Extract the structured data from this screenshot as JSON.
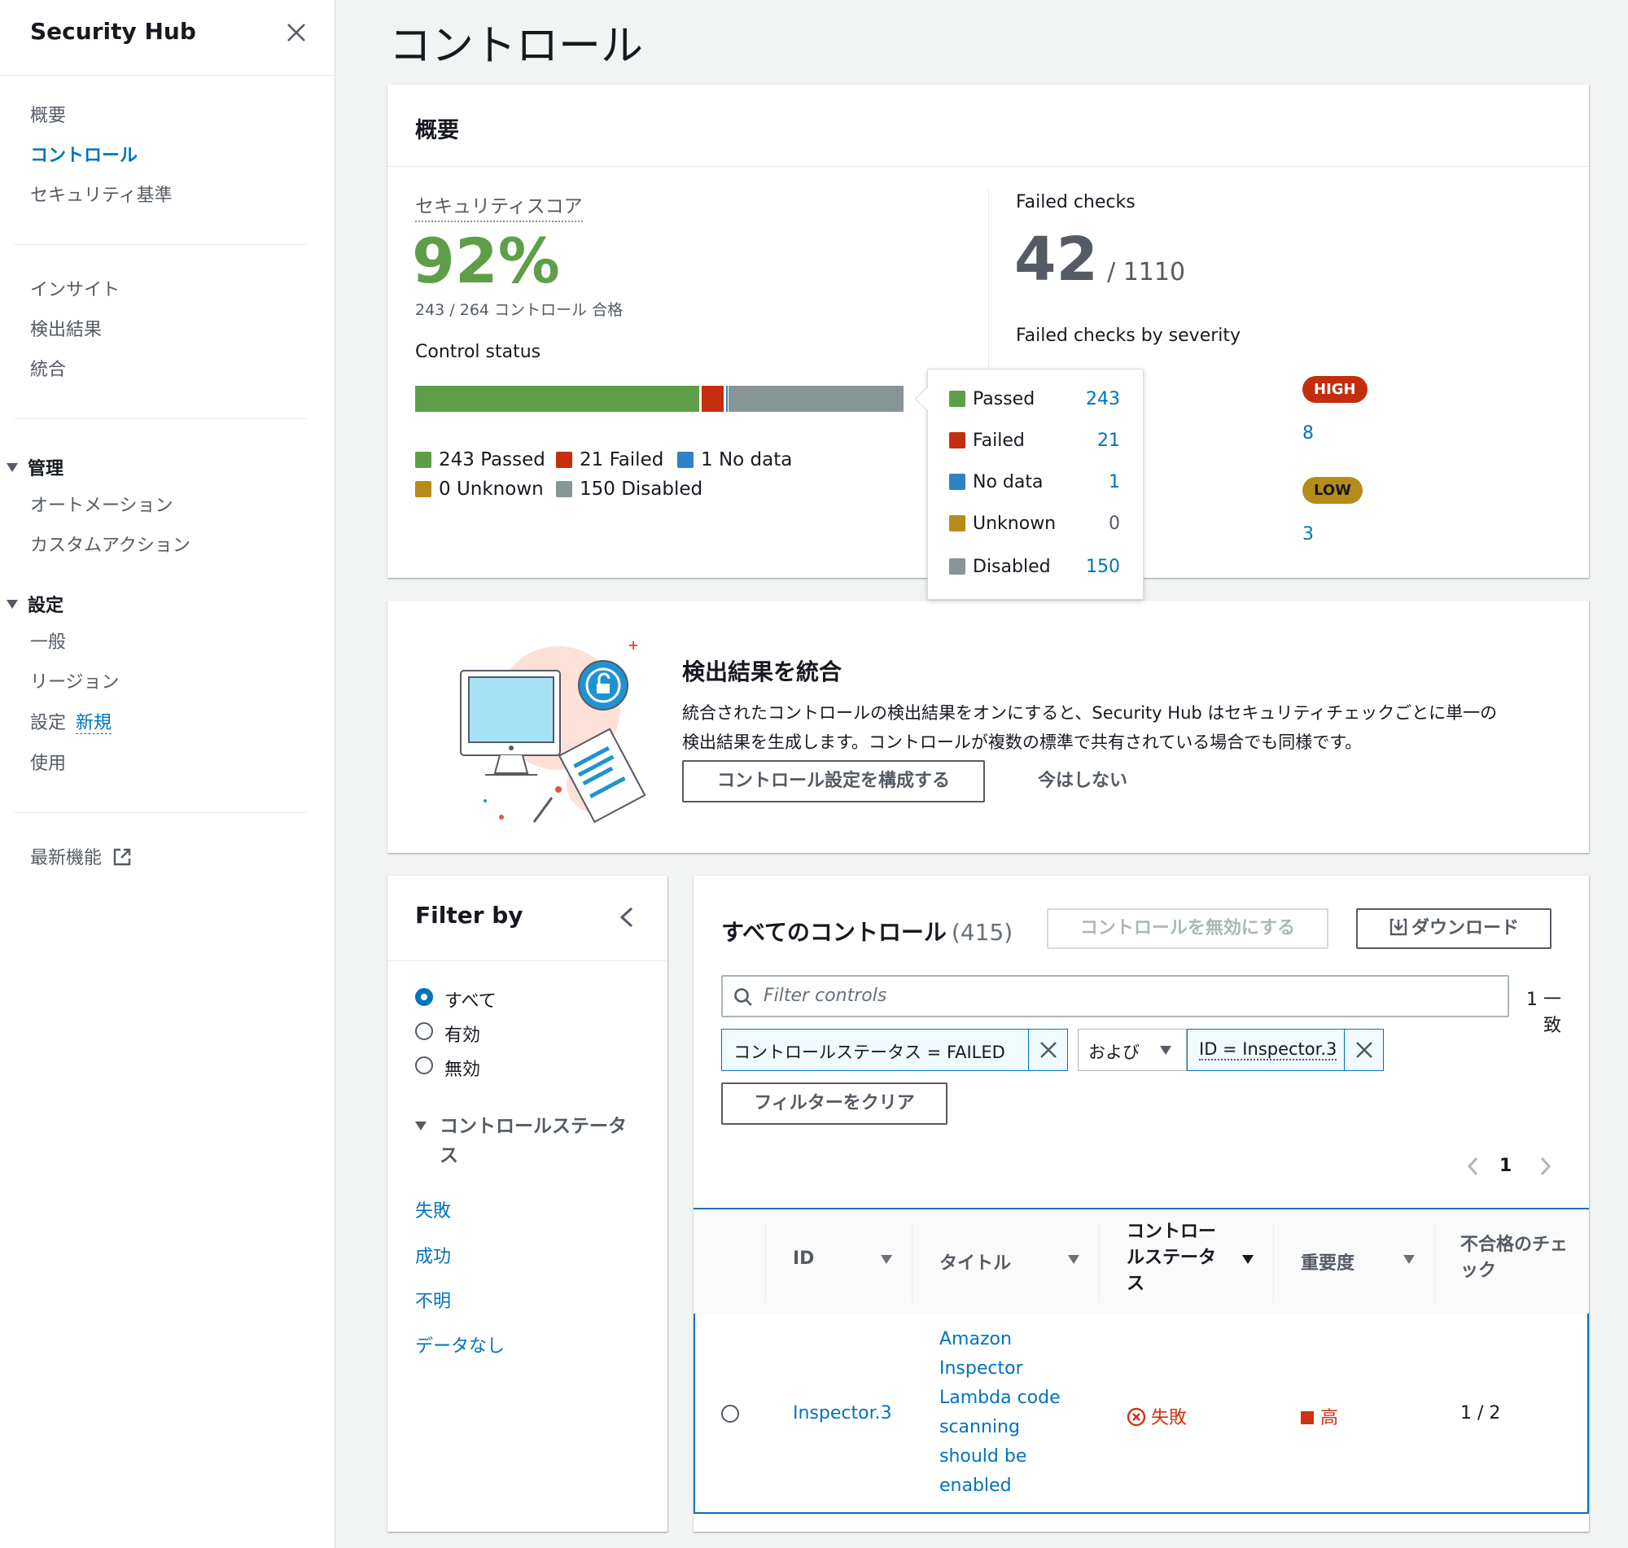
{
  "sidebar": {
    "title": "Security Hub",
    "nav1": [
      "概要",
      "コントロール",
      "セキュリティ基準"
    ],
    "nav2": [
      "インサイト",
      "検出結果",
      "統合"
    ],
    "group_admin": "管理",
    "admin_items": [
      "オートメーション",
      "カスタムアクション"
    ],
    "group_settings": "設定",
    "settings_items": [
      "一般",
      "リージョン"
    ],
    "settings_label": "設定",
    "settings_new": "新規",
    "usage": "使用",
    "whats_new": "最新機能"
  },
  "page": {
    "title": "コントロール"
  },
  "summary": {
    "header": "概要",
    "score_label": "セキュリティスコア",
    "score_value": "92%",
    "score_detail": "243 / 264 コントロール 合格",
    "control_status_label": "Control status",
    "bar": {
      "passed": 243,
      "failed": 21,
      "no_data": 1,
      "unknown": 0,
      "disabled": 150
    },
    "legend": [
      "243 Passed",
      "21 Failed",
      "1 No data",
      "0 Unknown",
      "150 Disabled"
    ],
    "failed_checks_label": "Failed checks",
    "failed_checks_value": "42",
    "failed_checks_total": "/ 1110",
    "by_severity_label": "Failed checks by severity",
    "severity": [
      {
        "label": "HIGH",
        "count": "8"
      },
      {
        "label": "LOW",
        "count": "3"
      }
    ]
  },
  "popover": {
    "rows": [
      {
        "label": "Passed",
        "value": "243"
      },
      {
        "label": "Failed",
        "value": "21"
      },
      {
        "label": "No data",
        "value": "1"
      },
      {
        "label": "Unknown",
        "value": "0"
      },
      {
        "label": "Disabled",
        "value": "150"
      }
    ]
  },
  "consolidate": {
    "title": "検出結果を統合",
    "line1": "統合されたコントロールの検出結果をオンにすると、Security Hub はセキュリティチェックごとに単一の",
    "line2": "検出結果を生成します。コントロールが複数の標準で共有されている場合でも同様です。",
    "configure_button": "コントロール設定を構成する",
    "not_now_button": "今はしない"
  },
  "filter_panel": {
    "title": "Filter by",
    "radios": [
      "すべて",
      "有効",
      "無効"
    ],
    "status_group": "コントロールステータ",
    "status_group_2": "ス",
    "status_links": [
      "失敗",
      "成功",
      "不明",
      "データなし"
    ]
  },
  "table_panel": {
    "title": "すべてのコントロール",
    "count": "(415)",
    "disable_button": "コントロールを無効にする",
    "download_button": "ダウンロード",
    "search_placeholder": "Filter controls",
    "match_count": "1 一致",
    "token1": "コントロールステータス = FAILED",
    "operator": "および",
    "token2": "ID = Inspector.3",
    "clear_button": "フィルターをクリア",
    "page": "1",
    "columns": [
      "ID",
      "タイトル",
      "コントロー",
      "ルステータ",
      "ス",
      "重要度",
      "不合格のチェ",
      "ック"
    ],
    "row": {
      "id": "Inspector.3",
      "title_lines": [
        "Amazon",
        "Inspector",
        "Lambda code",
        "scanning",
        "should be",
        "enabled"
      ],
      "status": "失敗",
      "severity": "高",
      "failed_checks": "1 / 2"
    }
  },
  "colors": {
    "passed": "#5f9e48",
    "failed": "#c42d0d",
    "no_data": "#2f82c4",
    "unknown": "#b58b1a",
    "disabled": "#879596",
    "link": "#0073bb",
    "score_green": "#5f9e48"
  }
}
